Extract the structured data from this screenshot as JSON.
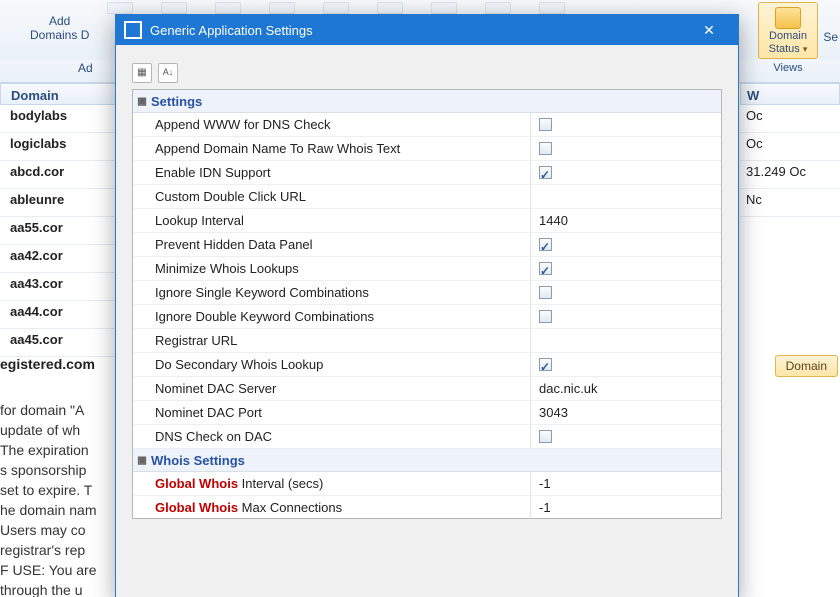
{
  "ribbon": {
    "add_domains_line1": "Add",
    "add_domains_line2": "Domains",
    "domains_d": "D",
    "domain_status_line1": "Domain",
    "domain_status_line2": "Status",
    "views_label": "Views",
    "ad_label": "Ad",
    "se_fragment": "Se"
  },
  "grid": {
    "domain_header": "Domain",
    "w_header": "W",
    "rows": [
      "bodylabs",
      "logiclabs",
      "abcd.cor",
      "ableunre",
      "aa55.cor",
      "aa42.cor",
      "aa43.cor",
      "aa44.cor",
      "aa45.cor"
    ],
    "right_rows": [
      "Oc",
      "Oc",
      "31.249    Oc",
      "Nc"
    ]
  },
  "registered_label": "egistered.com",
  "domain_btn": "Domain",
  "info_lines": [
    "for domain \"A",
    "update of wh",
    "",
    "The expiration",
    "s sponsorship",
    "set to expire. T",
    "he domain nam",
    " Users may co",
    "registrar's rep",
    "",
    "F USE: You are",
    "through the u"
  ],
  "dialog": {
    "title": "Generic Application Settings",
    "sort_btn1": "▦",
    "sort_btn2": "A↓",
    "categories": {
      "settings": "Settings",
      "whois": "Whois Settings"
    },
    "props": {
      "append_www": {
        "label": "Append WWW for DNS Check",
        "checked": false
      },
      "append_domain": {
        "label": "Append Domain Name To Raw Whois Text",
        "checked": false
      },
      "enable_idn": {
        "label": "Enable IDN Support",
        "checked": true
      },
      "custom_dbl": {
        "label": "Custom Double Click URL",
        "value": ""
      },
      "lookup_interval": {
        "label": "Lookup Interval",
        "value": "1440"
      },
      "prevent_hidden": {
        "label": "Prevent Hidden Data Panel",
        "checked": true
      },
      "min_whois": {
        "label": "Minimize Whois Lookups",
        "checked": true
      },
      "ignore_single": {
        "label": "Ignore Single Keyword Combinations",
        "checked": false
      },
      "ignore_double": {
        "label": "Ignore Double Keyword Combinations",
        "checked": false
      },
      "registrar_url": {
        "label": "Registrar URL",
        "value": ""
      },
      "secondary_whois": {
        "label": "Do Secondary Whois Lookup",
        "checked": true
      },
      "nominet_server": {
        "label": "Nominet DAC Server",
        "value": "dac.nic.uk"
      },
      "nominet_port": {
        "label": "Nominet DAC Port",
        "value": "3043"
      },
      "dns_check_dac": {
        "label": "DNS Check on DAC",
        "checked": false
      },
      "global_interval": {
        "prefix": "Global Whois",
        "suffix": " Interval (secs)",
        "value": "-1"
      },
      "global_maxconn": {
        "prefix": "Global Whois",
        "suffix": " Max Connections",
        "value": "-1"
      }
    }
  }
}
